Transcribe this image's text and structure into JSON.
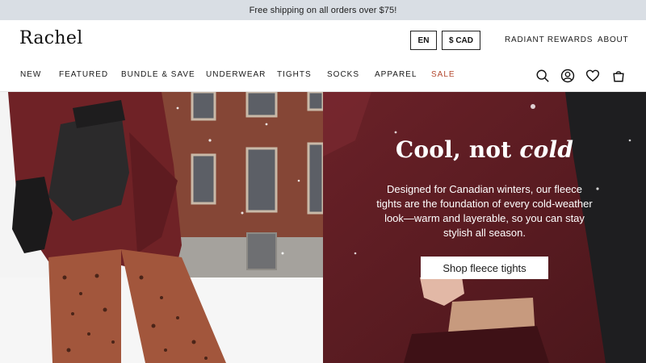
{
  "announcement": {
    "text": "Free shipping on all orders over $75!"
  },
  "header": {
    "logo": "Rachel",
    "language": "EN",
    "currency": "$ CAD",
    "links": {
      "rewards": "RADIANT REWARDS",
      "about": "ABOUT"
    }
  },
  "nav": {
    "items": [
      {
        "label": "NEW"
      },
      {
        "label": "FEATURED"
      },
      {
        "label": "BUNDLE & SAVE"
      },
      {
        "label": "UNDERWEAR"
      },
      {
        "label": "TIGHTS"
      },
      {
        "label": "SOCKS"
      },
      {
        "label": "APPAREL"
      },
      {
        "label": "SALE"
      }
    ],
    "sale_color": "#b3472e"
  },
  "icons": [
    "search-icon",
    "account-icon",
    "heart-icon",
    "bag-icon"
  ],
  "hero": {
    "title_regular": "Cool, not ",
    "title_italic": "cold",
    "body": "Designed for Canadian winters, our fleece tights are the foundation of every cold-weather look—warm and layerable, so you can stay stylish all season.",
    "button": "Shop fleece tights",
    "background_color": "#5a1c22"
  }
}
